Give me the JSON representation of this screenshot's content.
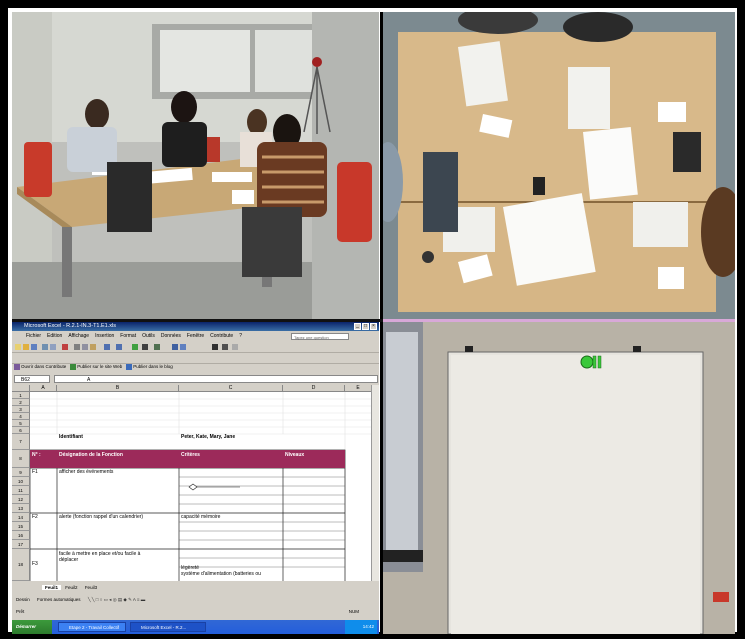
{
  "excel": {
    "title": "Microsoft Excel - R.2.1-IN.3-T1.E1.xls",
    "menu": [
      "Fichier",
      "Edition",
      "Affichage",
      "Insertion",
      "Format",
      "Outils",
      "Données",
      "Fenêtre",
      "Contribute",
      "?"
    ],
    "ask_placeholder": "Tapez une question",
    "contribute_toolbar": {
      "edit": "Ouvrir dans Contribute",
      "publish_web": "Publier sur le site Web",
      "publish_blog": "Publier dans le blog"
    },
    "name_box": "B62",
    "formula_value": "A",
    "columns": [
      "A",
      "B",
      "C",
      "D",
      "E"
    ],
    "rows": [
      "1",
      "2",
      "3",
      "4",
      "5",
      "6",
      "7",
      "8",
      "9",
      "10",
      "11",
      "12",
      "13",
      "14",
      "15",
      "16",
      "17",
      "18"
    ],
    "cells": {
      "b6": "Identifiant",
      "c6": "Peter, Kate, Mary, Jane",
      "a7": "N° :",
      "b7": "Désignation de la Fonction",
      "c7": "Critères",
      "d7": "Niveaux",
      "a8": "F1",
      "b8": "afficher des événements",
      "a13": "F2",
      "b13": "alerte (fonction rappel d'un calendrier)",
      "c13": "capacité mémoire",
      "b18a": "facile à mettre en place et/ou facile à",
      "b18b": "déplacer",
      "a18": "F3",
      "c18a": "légèreté",
      "c18b": "système d'alimentation (batteries ou"
    },
    "sheet_tabs": [
      "Feuil1",
      "Feuil2",
      "Feuil3"
    ],
    "draw_toolbar": {
      "draw": "Dessin",
      "autoshapes": "Formes automatiques"
    },
    "status": {
      "left": "Prêt",
      "right": "NUM"
    },
    "taskbar": {
      "start": "Démarrer",
      "items": [
        "Etape 2 - Travail Collectif",
        "Microsoft Excel - R.2..."
      ],
      "clock": "14:42"
    },
    "colors": {
      "header_maroon": "#9c2a5a",
      "title_bar": "#0a246a",
      "taskbar": "#245edb"
    }
  }
}
